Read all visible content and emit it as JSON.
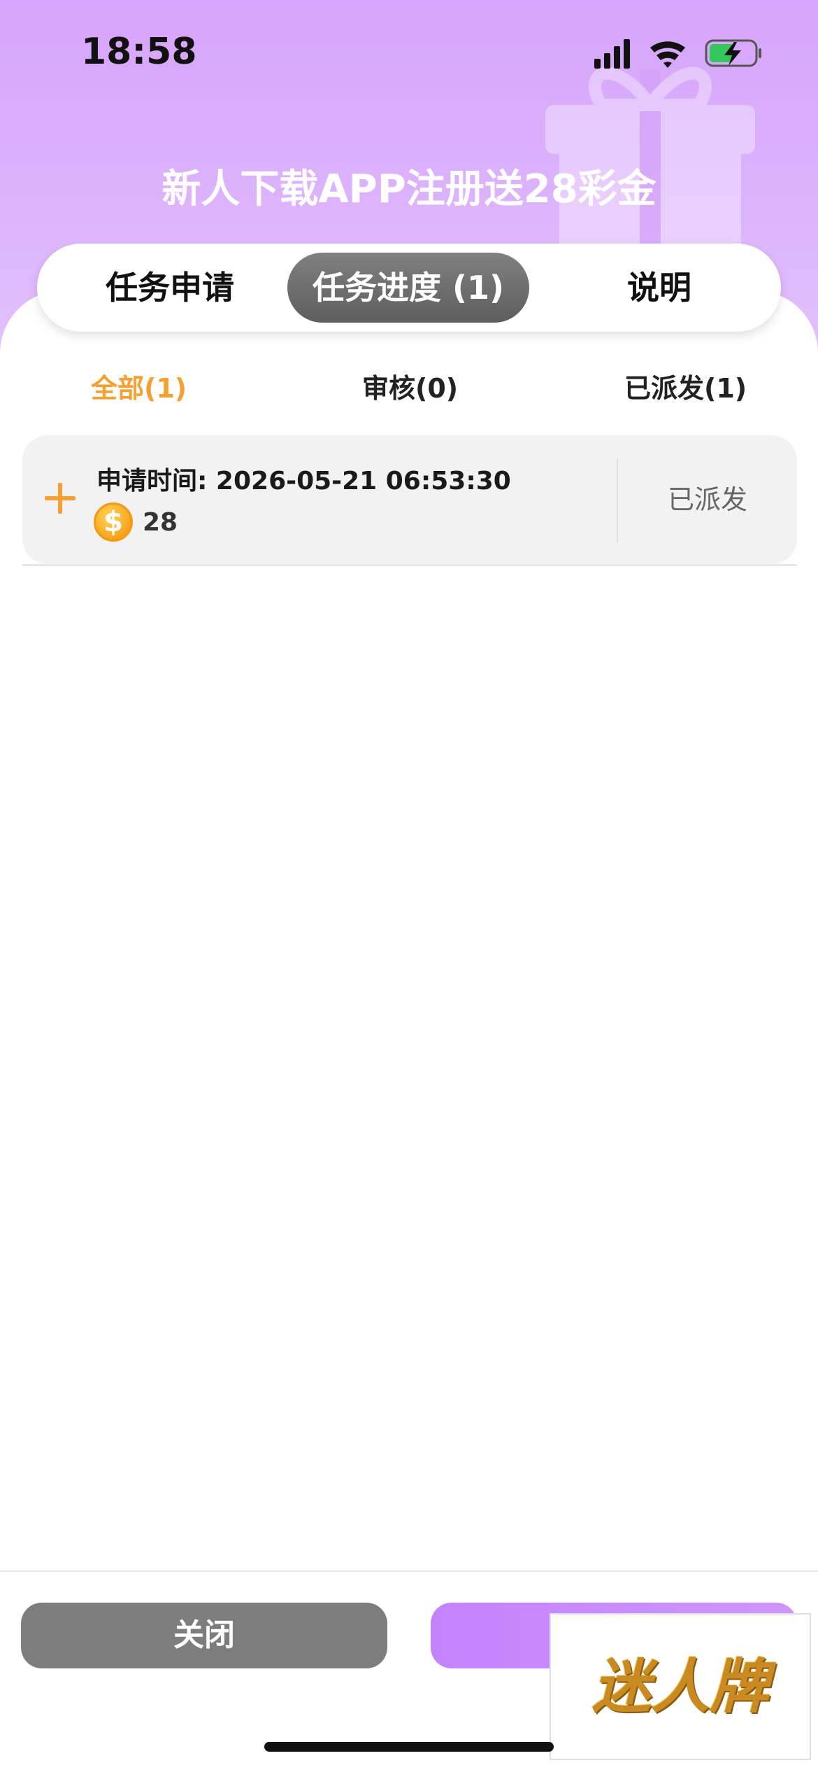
{
  "status_bar": {
    "time": "18:58"
  },
  "page_title": "新人下载APP注册送28彩金",
  "tabs": [
    {
      "label": "任务申请"
    },
    {
      "label": "任务进度 (1)"
    },
    {
      "label": "说明"
    }
  ],
  "subtabs": [
    {
      "label": "全部(1)"
    },
    {
      "label": "审核(0)"
    },
    {
      "label": "已派发(1)"
    }
  ],
  "record": {
    "apply_time": "申请时间: 2026-05-21 06:53:30",
    "coin_glyph": "$",
    "amount": "28",
    "status": "已派发"
  },
  "buttons": {
    "close_label": "关闭"
  },
  "watermark": {
    "text": "迷人牌"
  },
  "colors": {
    "header_gradient_start": "#d7a4fb",
    "accent_orange": "#f7a032",
    "active_tab": "#6a6a6a",
    "close_button": "#7d7d7d",
    "primary_button": "#c483fb"
  },
  "icons": [
    "signal-icon",
    "wifi-icon",
    "battery-charging-icon",
    "gift-icon",
    "plus-icon",
    "coin-icon"
  ]
}
